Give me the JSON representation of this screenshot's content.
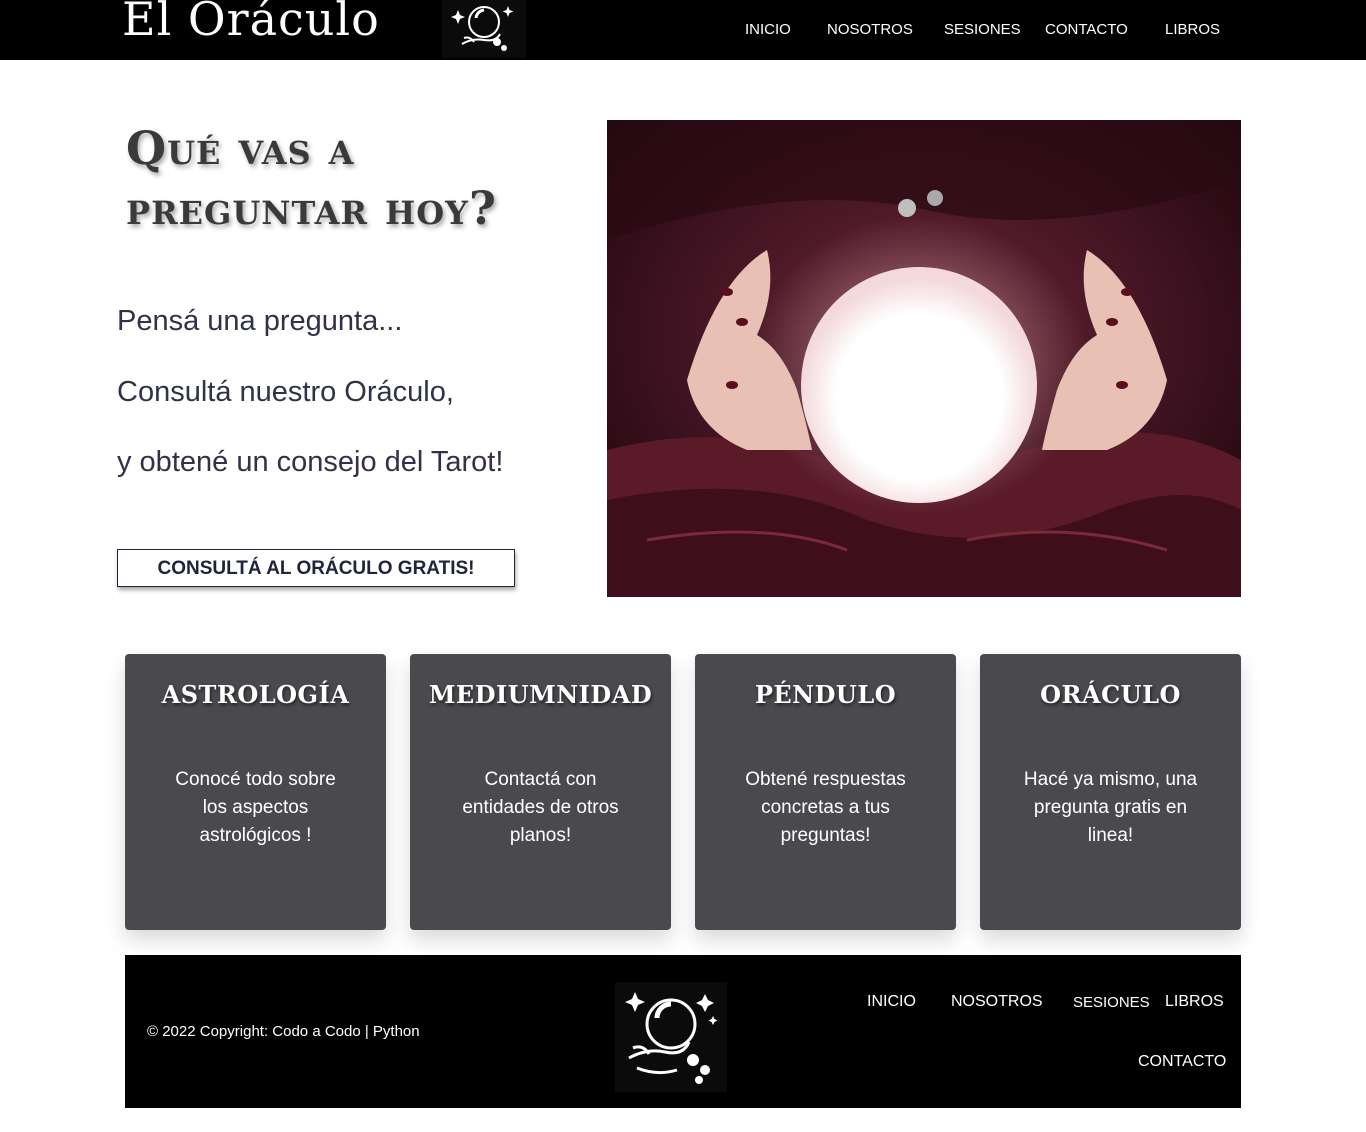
{
  "header": {
    "brand": "El Oráculo",
    "nav": [
      "INICIO",
      "NOSOTROS",
      "SESIONES",
      "CONTACTO",
      "LIBROS"
    ]
  },
  "hero": {
    "title": "Qué vas a preguntar hoy?",
    "lines": [
      "Pensá una pregunta...",
      "Consultá nuestro Oráculo,",
      "y obtené un consejo del Tarot!"
    ],
    "cta_label": "CONSULTÁ  AL ORÁCULO GRATIS!"
  },
  "cards": [
    {
      "title": "ASTROLOGÍA",
      "text": "Conocé todo sobre los aspectos astrológicos !"
    },
    {
      "title": "MEDIUMNIDAD",
      "text": "Contactá con entidades de otros planos!"
    },
    {
      "title": "PÉNDULO",
      "text": "Obtené respuestas concretas a tus preguntas!"
    },
    {
      "title": "ORÁCULO",
      "text": "Hacé ya mismo, una pregunta gratis en linea!"
    }
  ],
  "footer": {
    "copyright": "© 2022 Copyright: Codo a Codo | Python",
    "nav": [
      "INICIO",
      "NOSOTROS",
      "SESIONES",
      "LIBROS",
      "CONTACTO"
    ]
  },
  "colors": {
    "header_bg": "#000000",
    "card_bg": "#4a4a4e",
    "cta_text": "#20233a",
    "hero_text": "#2f3248"
  },
  "icons": [
    "crystal-ball-hand-logo"
  ]
}
